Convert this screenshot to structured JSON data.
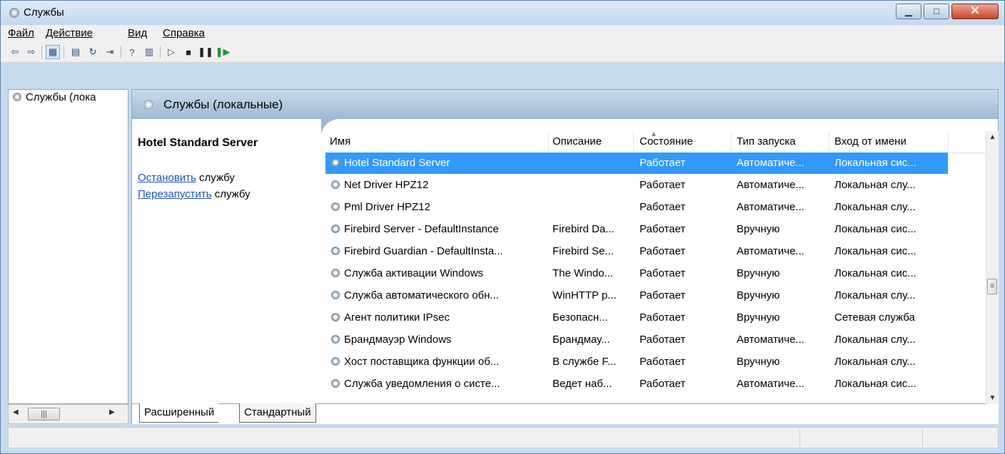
{
  "window": {
    "title": "Службы"
  },
  "menu": {
    "file": "Файл",
    "action": "Действие",
    "view": "Вид",
    "help": "Справка"
  },
  "tree": {
    "root_label": "Службы (лока"
  },
  "main": {
    "header_title": "Службы (локальные)",
    "selected_service": "Hotel Standard Server",
    "stop_link": "Остановить",
    "stop_suffix": " службу",
    "restart_link": "Перезапустить",
    "restart_suffix": " службу"
  },
  "grid": {
    "columns": [
      "Имя",
      "Описание",
      "Состояние",
      "Тип запуска",
      "Вход от имени"
    ],
    "rows": [
      [
        "Hotel Standard Server",
        "",
        "Работает",
        "Автоматиче...",
        "Локальная сис..."
      ],
      [
        "Net Driver HPZ12",
        "",
        "Работает",
        "Автоматиче...",
        "Локальная слу..."
      ],
      [
        "Pml Driver HPZ12",
        "",
        "Работает",
        "Автоматиче...",
        "Локальная слу..."
      ],
      [
        "Firebird Server - DefaultInstance",
        "Firebird Da...",
        "Работает",
        "Вручную",
        "Локальная сис..."
      ],
      [
        "Firebird Guardian - DefaultInsta...",
        "Firebird Se...",
        "Работает",
        "Автоматиче...",
        "Локальная сис..."
      ],
      [
        "Служба активации Windows",
        "The Windo...",
        "Работает",
        "Вручную",
        "Локальная сис..."
      ],
      [
        "Служба автоматического обн...",
        "WinHTTP р...",
        "Работает",
        "Вручную",
        "Локальная слу..."
      ],
      [
        "Агент политики IPsec",
        "Безопасн...",
        "Работает",
        "Вручную",
        "Сетевая служба"
      ],
      [
        "Брандмауэр Windows",
        "Брандмау...",
        "Работает",
        "Автоматиче...",
        "Локальная слу..."
      ],
      [
        "Хост поставщика функции об...",
        "В службе F...",
        "Работает",
        "Вручную",
        "Локальная слу..."
      ],
      [
        "Служба уведомления о систе...",
        "Ведет наб...",
        "Работает",
        "Автоматиче...",
        "Локальная сис..."
      ]
    ]
  },
  "tabs": {
    "extended": "Расширенный",
    "standard": "Стандартный"
  },
  "icons": {
    "app": "services-gear-icon",
    "back": "back-arrow-icon",
    "forward": "forward-arrow-icon",
    "play": "play-icon",
    "stop": "stop-icon",
    "pause": "pause-icon",
    "restart": "restart-icon"
  },
  "colors": {
    "selection": "#3399ff",
    "link": "#1a55b4",
    "header_blue": "#9fb8d3"
  }
}
